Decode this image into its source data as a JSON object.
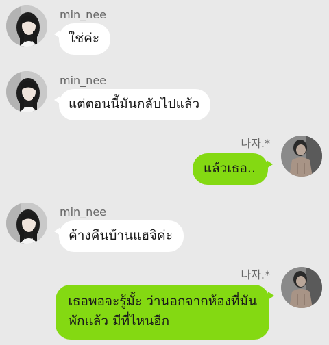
{
  "colors": {
    "background": "#e9e9e9",
    "incoming_bubble": "#ffffff",
    "outgoing_bubble": "#84d912",
    "name_text": "#666666",
    "message_text": "#1a1a1a"
  },
  "messages": [
    {
      "sender": "min_nee",
      "direction": "incoming",
      "text": "ใช่ค่ะ"
    },
    {
      "sender": "min_nee",
      "direction": "incoming",
      "text": "แต่ตอนนี้มันกลับไปแล้ว"
    },
    {
      "sender": "나자.*",
      "direction": "outgoing",
      "text": "แล้วเธอ.."
    },
    {
      "sender": "min_nee",
      "direction": "incoming",
      "text": "ค้างคืนบ้านแฮจิค่ะ"
    },
    {
      "sender": "나자.*",
      "direction": "outgoing",
      "lines": [
        "เธอพอจะรู้มั้ะ ว่านอกจากห้องที่มัน",
        "พักแล้ว มีที่ไหนอีก"
      ]
    }
  ]
}
